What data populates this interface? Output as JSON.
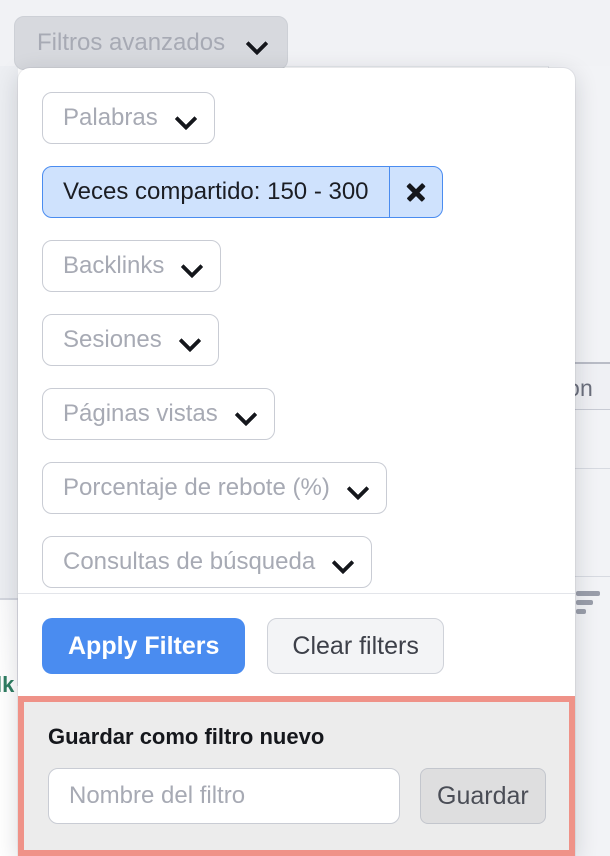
{
  "trigger": {
    "label": "Filtros avanzados",
    "chevron_icon": "chevron-down-icon"
  },
  "panel": {
    "filter_selectors": [
      {
        "label": "Palabras",
        "type": "select",
        "chevron_icon": "chevron-down-icon"
      },
      {
        "label": "Veces compartido: 150 - 300",
        "type": "active-chip",
        "close_icon": "close-icon"
      },
      {
        "label": "Backlinks",
        "type": "select",
        "chevron_icon": "chevron-down-icon"
      },
      {
        "label": "Sesiones",
        "type": "select",
        "chevron_icon": "chevron-down-icon"
      },
      {
        "label": "Páginas vistas",
        "type": "select",
        "chevron_icon": "chevron-down-icon"
      },
      {
        "label": "Porcentaje de rebote (%)",
        "type": "select",
        "chevron_icon": "chevron-down-icon"
      },
      {
        "label": "Consultas de búsqueda",
        "type": "select",
        "chevron_icon": "chevron-down-icon"
      }
    ],
    "actions": {
      "apply_label": "Apply Filters",
      "clear_label": "Clear filters"
    },
    "save_section": {
      "title": "Guardar como filtro nuevo",
      "input_value": "",
      "input_placeholder": "Nombre del filtro",
      "save_label": "Guardar",
      "highlight_color": "#ef9288"
    }
  },
  "background": {
    "column_header": "bon",
    "green_text": "lk",
    "sort_icon": "sort-filter-icon"
  },
  "colors": {
    "accent_blue": "#4a8cf0",
    "chip_fill": "#cfe2fd",
    "highlight": "#ef9288",
    "page_bg": "#f1f2f5",
    "muted_text": "#a7aab4"
  }
}
